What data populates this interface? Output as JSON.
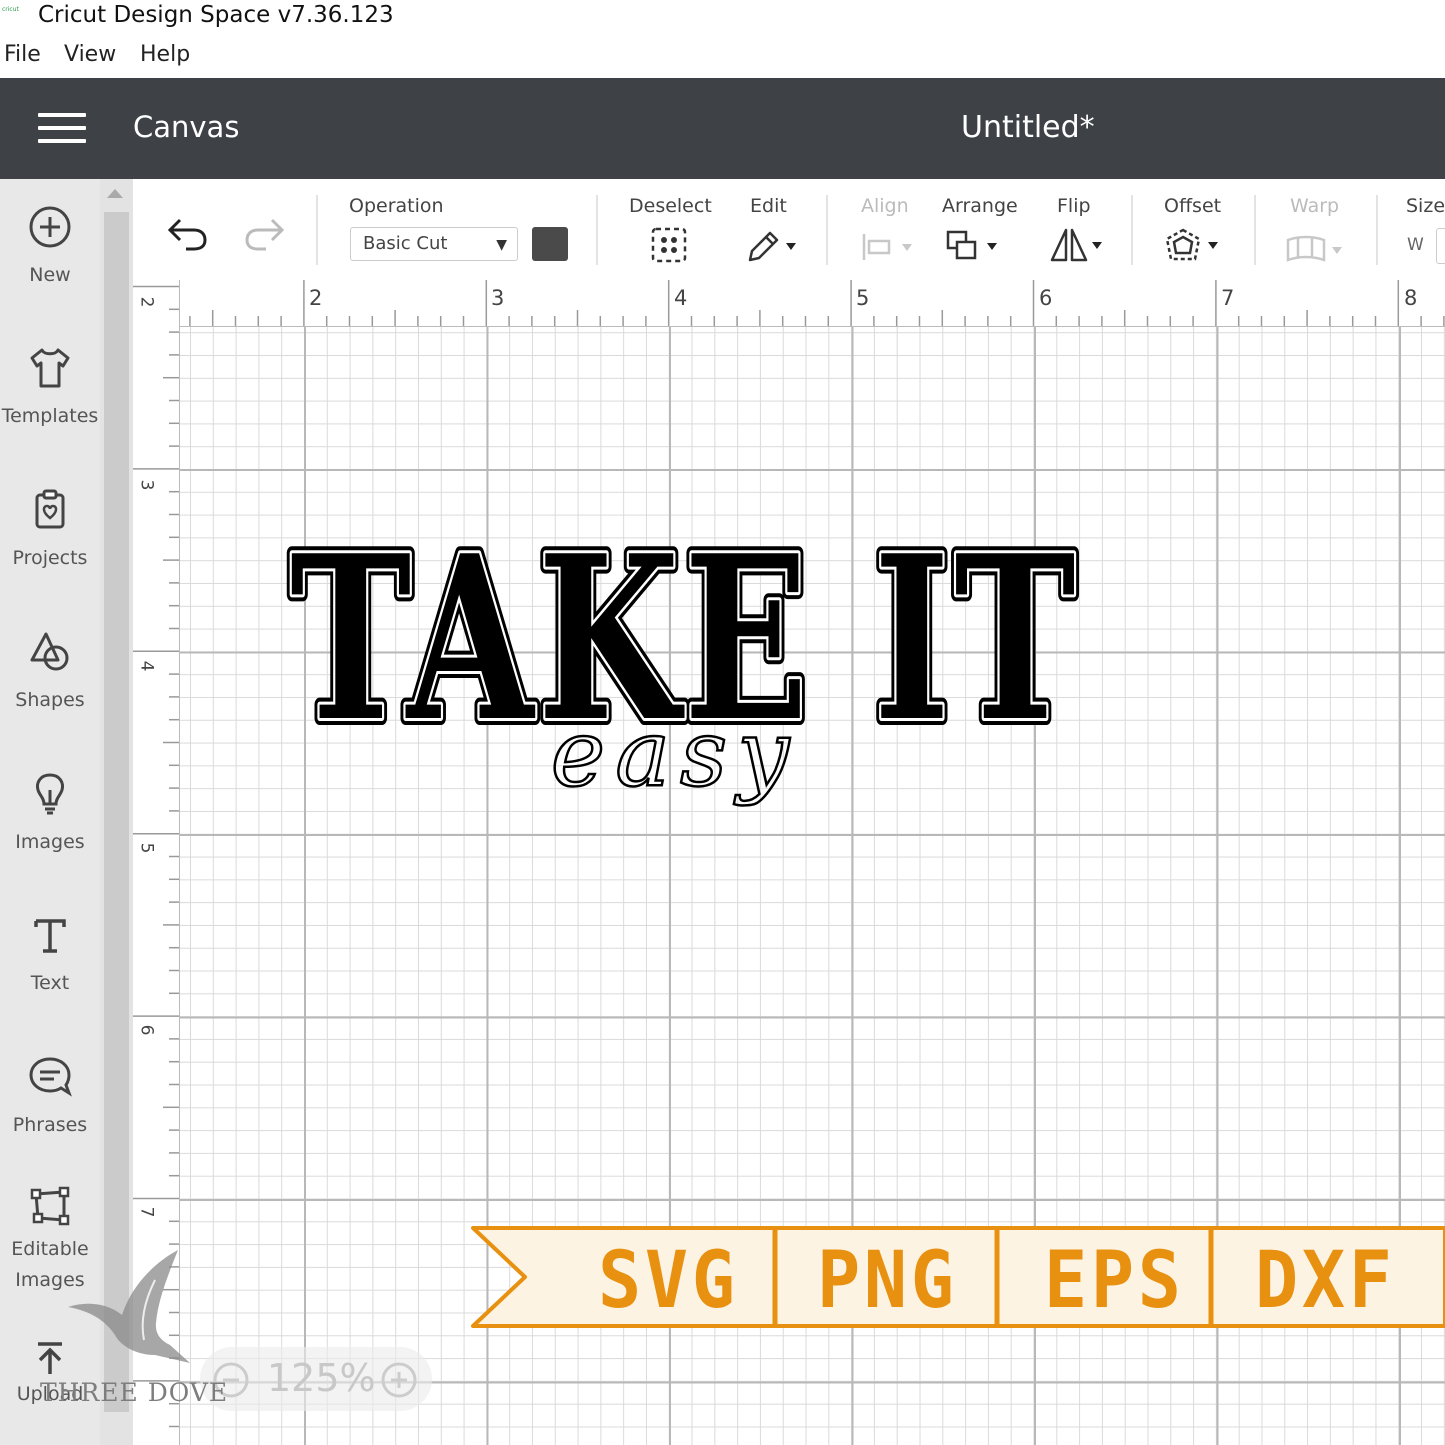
{
  "app": {
    "title": "Cricut Design Space  v7.36.123"
  },
  "menubar": {
    "items": [
      "File",
      "View",
      "Help"
    ]
  },
  "header": {
    "section": "Canvas",
    "document_title": "Untitled*"
  },
  "sidebar": {
    "items": [
      {
        "label": "New",
        "icon": "plus-circle-icon"
      },
      {
        "label": "Templates",
        "icon": "tshirt-icon"
      },
      {
        "label": "Projects",
        "icon": "project-icon"
      },
      {
        "label": "Shapes",
        "icon": "shapes-icon"
      },
      {
        "label": "Images",
        "icon": "lightbulb-icon"
      },
      {
        "label": "Text",
        "icon": "text-icon"
      },
      {
        "label": "Phrases",
        "icon": "speech-bubble-icon"
      },
      {
        "label": "Editable\nImages",
        "icon": "editable-images-icon"
      },
      {
        "label": "Upload",
        "icon": "upload-icon"
      }
    ]
  },
  "toolbar": {
    "operation_label": "Operation",
    "operation_value": "Basic Cut",
    "operation_color": "#4a4a4a",
    "deselect_label": "Deselect",
    "edit_label": "Edit",
    "align_label": "Align",
    "arrange_label": "Arrange",
    "flip_label": "Flip",
    "offset_label": "Offset",
    "warp_label": "Warp",
    "size_label": "Size",
    "size_w": "W"
  },
  "ruler": {
    "horizontal": [
      "2",
      "3",
      "4",
      "5",
      "6",
      "7",
      "8"
    ],
    "vertical": [
      "2",
      "3",
      "4",
      "5",
      "6",
      "7"
    ]
  },
  "design": {
    "headline": "TAKE IT",
    "script": "easy"
  },
  "banner": {
    "formats": [
      "SVG",
      "PNG",
      "EPS",
      "DXF"
    ],
    "accent": "#e8900f",
    "fill": "#fdf3e2"
  },
  "zoom": {
    "value": "125%"
  },
  "watermark": {
    "text": "THREE DOVE"
  }
}
